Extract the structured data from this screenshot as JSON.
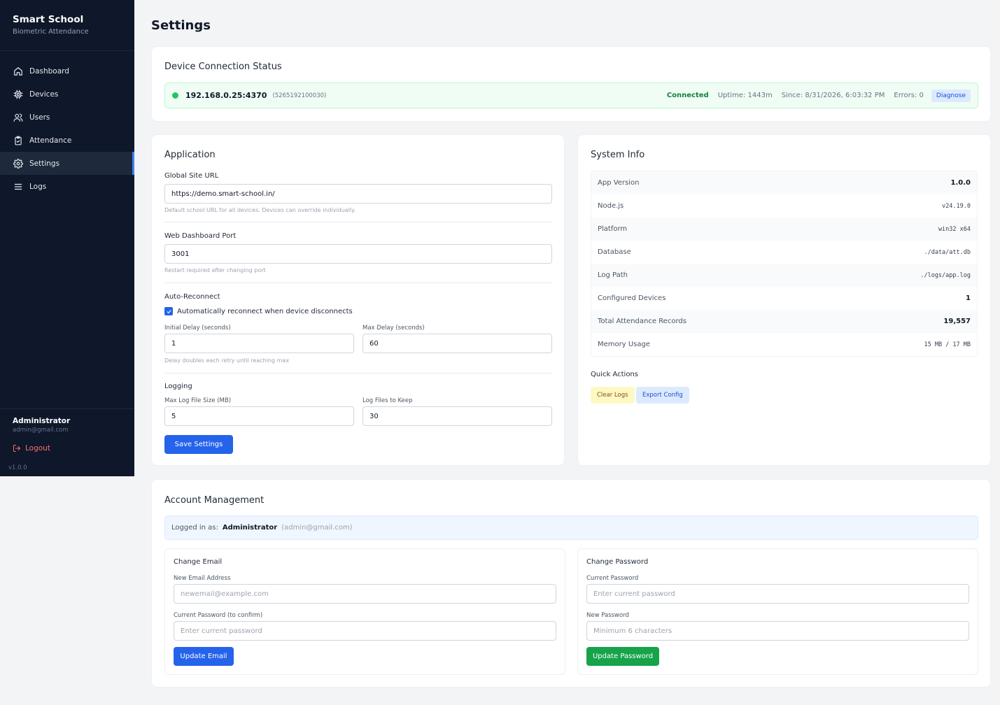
{
  "sidebar": {
    "brand_title": "Smart School",
    "brand_subtitle": "Biometric Attendance",
    "items": [
      {
        "label": "Dashboard",
        "icon": "home-icon"
      },
      {
        "label": "Devices",
        "icon": "chip-icon"
      },
      {
        "label": "Users",
        "icon": "users-icon"
      },
      {
        "label": "Attendance",
        "icon": "clipboard-check-icon"
      },
      {
        "label": "Settings",
        "icon": "gear-icon",
        "active": true
      },
      {
        "label": "Logs",
        "icon": "list-icon"
      }
    ],
    "admin_name": "Administrator",
    "admin_email": "admin@gmail.com",
    "logout_label": "Logout",
    "version": "v1.0.0"
  },
  "page": {
    "title": "Settings"
  },
  "device_status": {
    "title": "Device Connection Status",
    "ip": "192.168.0.25:4370",
    "serial": "(5265192100030)",
    "status": "Connected",
    "uptime": "Uptime: 1443m",
    "since": "Since: 8/31/2026, 6:03:32 PM",
    "errors": "Errors: 0",
    "diagnose_label": "Diagnose"
  },
  "application": {
    "title": "Application",
    "site_url_label": "Global Site URL",
    "site_url_value": "https://demo.smart-school.in/",
    "site_url_hint": "Default school URL for all devices. Devices can override individually.",
    "port_label": "Web Dashboard Port",
    "port_value": "3001",
    "port_hint": "Restart required after changing port",
    "reconnect_label": "Auto-Reconnect",
    "reconnect_checkbox": "Automatically reconnect when device disconnects",
    "initial_delay_label": "Initial Delay (seconds)",
    "initial_delay_value": "1",
    "max_delay_label": "Max Delay (seconds)",
    "max_delay_value": "60",
    "delay_hint": "Delay doubles each retry until reaching max",
    "logging_label": "Logging",
    "max_log_label": "Max Log File Size (MB)",
    "max_log_value": "5",
    "log_keep_label": "Log Files to Keep",
    "log_keep_value": "30",
    "save_label": "Save Settings"
  },
  "system_info": {
    "title": "System Info",
    "rows": [
      {
        "key": "App Version",
        "value": "1.0.0"
      },
      {
        "key": "Node.js",
        "value": "v24.19.0"
      },
      {
        "key": "Platform",
        "value": "win32 x64"
      },
      {
        "key": "Database",
        "value": "./data/att.db"
      },
      {
        "key": "Log Path",
        "value": "./logs/app.log"
      },
      {
        "key": "Configured Devices",
        "value": "1"
      },
      {
        "key": "Total Attendance Records",
        "value": "19,557"
      },
      {
        "key": "Memory Usage",
        "value": "15 MB / 17 MB"
      }
    ],
    "quick_actions_label": "Quick Actions",
    "clear_logs_label": "Clear Logs",
    "export_config_label": "Export Config"
  },
  "account": {
    "title": "Account Management",
    "logged_in_label": "Logged in as:",
    "logged_in_name": "Administrator",
    "logged_in_email": "(admin@gmail.com)",
    "change_email": {
      "title": "Change Email",
      "new_email_label": "New Email Address",
      "new_email_placeholder": "newemail@example.com",
      "confirm_label": "Current Password (to confirm)",
      "confirm_placeholder": "Enter current password",
      "button": "Update Email"
    },
    "change_password": {
      "title": "Change Password",
      "current_label": "Current Password",
      "current_placeholder": "Enter current password",
      "new_label": "New Password",
      "new_placeholder": "Minimum 6 characters",
      "button": "Update Password"
    }
  }
}
